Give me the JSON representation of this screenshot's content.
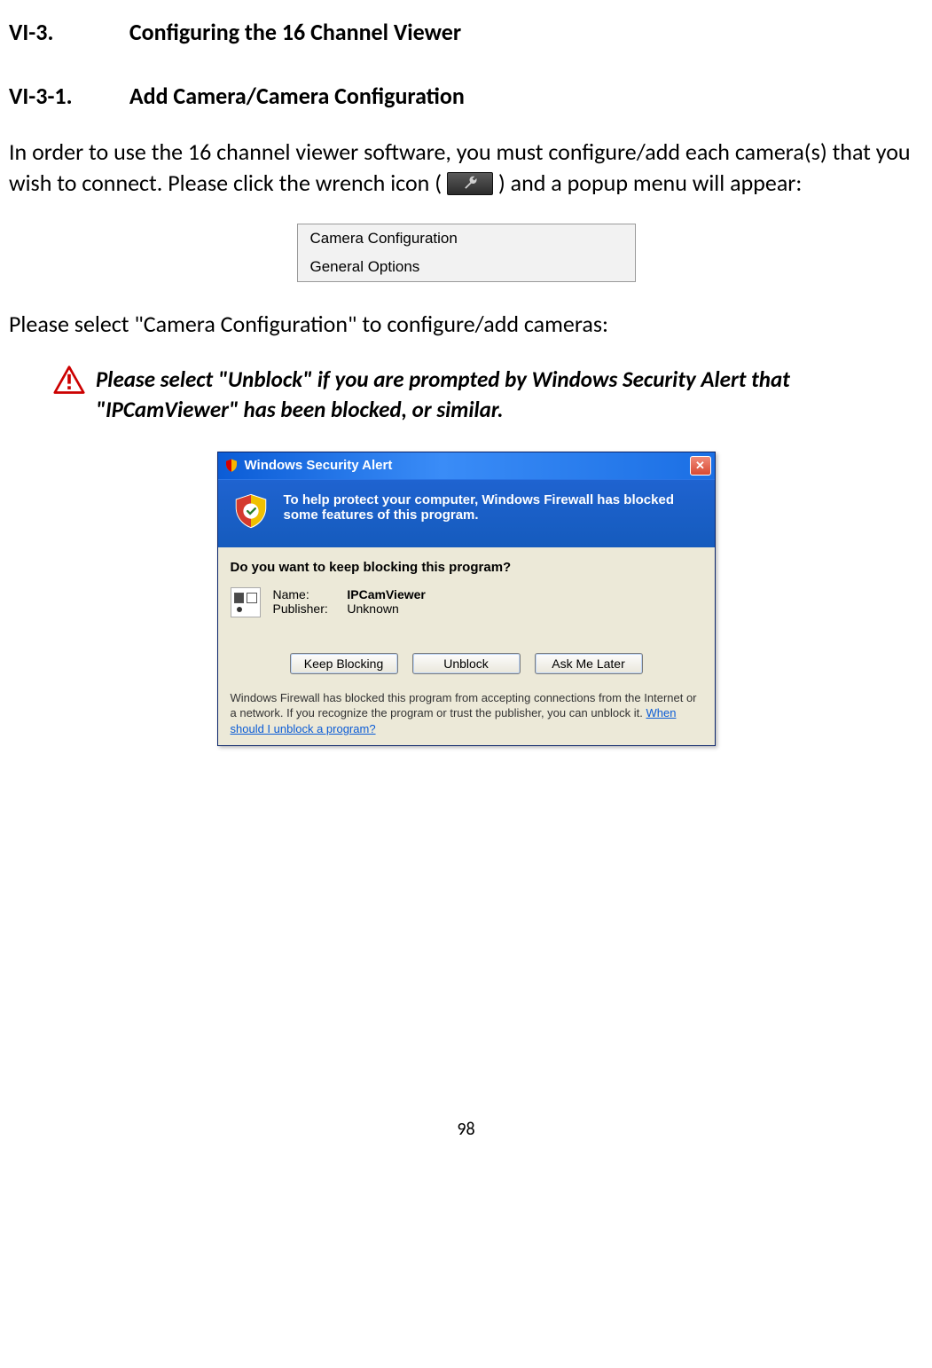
{
  "section": {
    "num": "VI-3.",
    "title": "Configuring the 16 Channel Viewer"
  },
  "subsection": {
    "num": "VI-3-1.",
    "title": "Add Camera/Camera Configuration"
  },
  "para1a": "In order to use the 16 channel viewer software, you must configure/add each camera(s) that you wish to connect. Please click the wrench icon (",
  "para1b": ") and a popup menu will appear:",
  "popup": {
    "item1": "Camera Configuration",
    "item2": "General Options"
  },
  "para2": "Please select \"Camera Configuration\" to configure/add cameras:",
  "warning": "Please select \"Unblock\" if you are prompted by Windows Security Alert that \"IPCamViewer\" has been blocked, or similar.",
  "dialog": {
    "title": "Windows Security Alert",
    "message": "To help protect your computer, Windows Firewall has blocked some features of this program.",
    "question": "Do you want to keep blocking this program?",
    "name_label": "Name:",
    "name_value": "IPCamViewer",
    "publisher_label": "Publisher:",
    "publisher_value": "Unknown",
    "keep_blocking": "Keep Blocking",
    "unblock": "Unblock",
    "ask_later": "Ask Me Later",
    "explain_a": "Windows Firewall has blocked this program from accepting connections from the Internet or a network. If you recognize the program or trust the publisher, you can unblock it. ",
    "explain_link": "When should I unblock a program?"
  },
  "page_number": "98"
}
